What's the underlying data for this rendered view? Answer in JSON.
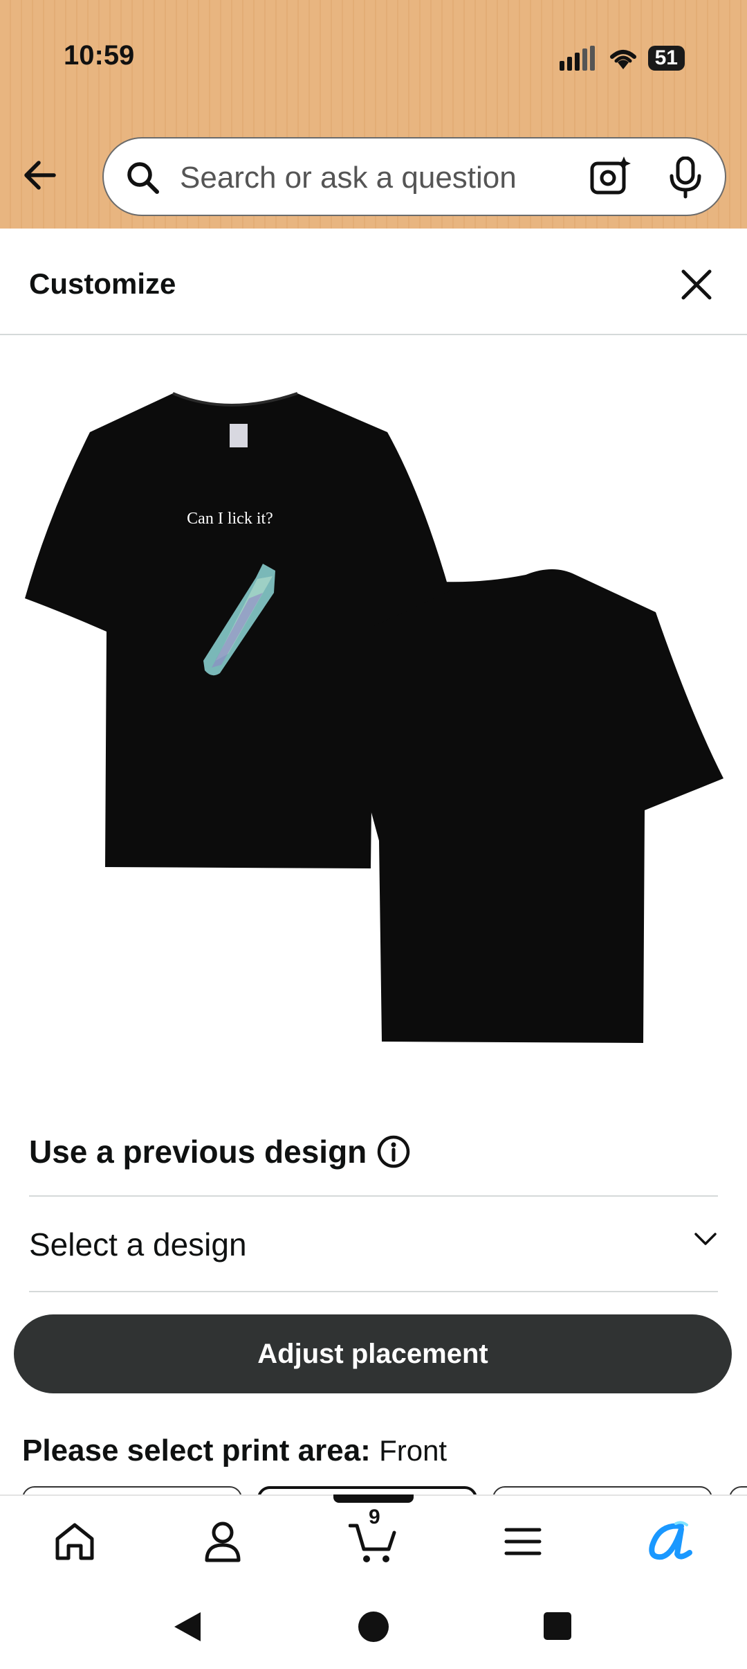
{
  "status_bar": {
    "time": "10:59",
    "battery": "51"
  },
  "search": {
    "placeholder": "Search or ask a question"
  },
  "customize": {
    "title": "Customize"
  },
  "product": {
    "shirt_text": "Can I lick it?",
    "views": [
      "front",
      "back"
    ],
    "shirt_color": "#0c0c0c"
  },
  "previous_design": {
    "title": "Use a previous design",
    "select_label": "Select a design"
  },
  "adjust_button": {
    "label": "Adjust placement"
  },
  "print_area": {
    "label": "Please select print area:",
    "value": "Front"
  },
  "cart": {
    "count": "9"
  },
  "bottom_nav": [
    "home-icon",
    "account-icon",
    "cart-icon",
    "menu-icon",
    "rufus-icon"
  ],
  "colors": {
    "header": "#e8b580",
    "button": "#303333",
    "accent": "#1a98ff"
  }
}
